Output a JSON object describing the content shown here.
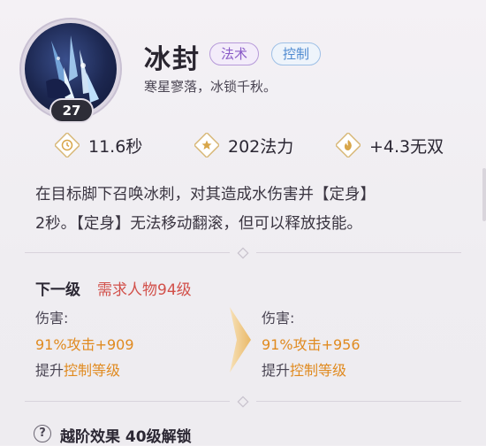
{
  "skill": {
    "name": "冰封",
    "tags": [
      "法术",
      "控制"
    ],
    "subtitle": "寒星寥落，冰锁千秋。",
    "level": "27",
    "icon": "ice-shard-skill-icon"
  },
  "stats": {
    "cooldown": "11.6秒",
    "cost": "202法力",
    "bonus": "+4.3无双"
  },
  "description": {
    "line1": "在目标脚下召唤冰刺，对其造成水伤害并【定身】",
    "line2": "2秒。【定身】无法移动翻滚，但可以释放技能。"
  },
  "next_level": {
    "title": "下一级",
    "requirement": "需求人物94级",
    "current": {
      "label": "伤害:",
      "value": "91%攻击+909",
      "upgrade_prefix": "提升",
      "upgrade_highlight": "控制等级"
    },
    "next": {
      "label": "伤害:",
      "value": "91%攻击+956",
      "upgrade_prefix": "提升",
      "upgrade_highlight": "控制等级"
    }
  },
  "advance": {
    "help": "?",
    "text": "越阶效果 40级解锁"
  },
  "colors": {
    "accent_orange": "#e08a1f",
    "requirement_red": "#d2504a",
    "tag_magic": "#8a5cc7",
    "tag_control": "#4f8ad0"
  }
}
